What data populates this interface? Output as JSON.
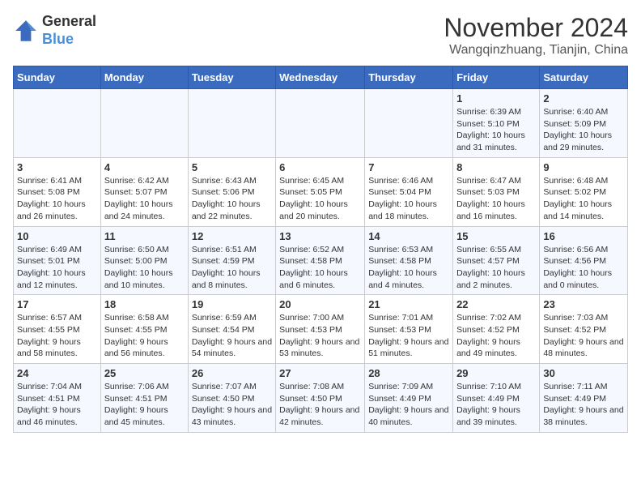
{
  "header": {
    "logo_general": "General",
    "logo_blue": "Blue",
    "month_title": "November 2024",
    "location": "Wangqinzhuang, Tianjin, China"
  },
  "weekdays": [
    "Sunday",
    "Monday",
    "Tuesday",
    "Wednesday",
    "Thursday",
    "Friday",
    "Saturday"
  ],
  "weeks": [
    [
      {
        "day": "",
        "info": ""
      },
      {
        "day": "",
        "info": ""
      },
      {
        "day": "",
        "info": ""
      },
      {
        "day": "",
        "info": ""
      },
      {
        "day": "",
        "info": ""
      },
      {
        "day": "1",
        "info": "Sunrise: 6:39 AM\nSunset: 5:10 PM\nDaylight: 10 hours and 31 minutes."
      },
      {
        "day": "2",
        "info": "Sunrise: 6:40 AM\nSunset: 5:09 PM\nDaylight: 10 hours and 29 minutes."
      }
    ],
    [
      {
        "day": "3",
        "info": "Sunrise: 6:41 AM\nSunset: 5:08 PM\nDaylight: 10 hours and 26 minutes."
      },
      {
        "day": "4",
        "info": "Sunrise: 6:42 AM\nSunset: 5:07 PM\nDaylight: 10 hours and 24 minutes."
      },
      {
        "day": "5",
        "info": "Sunrise: 6:43 AM\nSunset: 5:06 PM\nDaylight: 10 hours and 22 minutes."
      },
      {
        "day": "6",
        "info": "Sunrise: 6:45 AM\nSunset: 5:05 PM\nDaylight: 10 hours and 20 minutes."
      },
      {
        "day": "7",
        "info": "Sunrise: 6:46 AM\nSunset: 5:04 PM\nDaylight: 10 hours and 18 minutes."
      },
      {
        "day": "8",
        "info": "Sunrise: 6:47 AM\nSunset: 5:03 PM\nDaylight: 10 hours and 16 minutes."
      },
      {
        "day": "9",
        "info": "Sunrise: 6:48 AM\nSunset: 5:02 PM\nDaylight: 10 hours and 14 minutes."
      }
    ],
    [
      {
        "day": "10",
        "info": "Sunrise: 6:49 AM\nSunset: 5:01 PM\nDaylight: 10 hours and 12 minutes."
      },
      {
        "day": "11",
        "info": "Sunrise: 6:50 AM\nSunset: 5:00 PM\nDaylight: 10 hours and 10 minutes."
      },
      {
        "day": "12",
        "info": "Sunrise: 6:51 AM\nSunset: 4:59 PM\nDaylight: 10 hours and 8 minutes."
      },
      {
        "day": "13",
        "info": "Sunrise: 6:52 AM\nSunset: 4:58 PM\nDaylight: 10 hours and 6 minutes."
      },
      {
        "day": "14",
        "info": "Sunrise: 6:53 AM\nSunset: 4:58 PM\nDaylight: 10 hours and 4 minutes."
      },
      {
        "day": "15",
        "info": "Sunrise: 6:55 AM\nSunset: 4:57 PM\nDaylight: 10 hours and 2 minutes."
      },
      {
        "day": "16",
        "info": "Sunrise: 6:56 AM\nSunset: 4:56 PM\nDaylight: 10 hours and 0 minutes."
      }
    ],
    [
      {
        "day": "17",
        "info": "Sunrise: 6:57 AM\nSunset: 4:55 PM\nDaylight: 9 hours and 58 minutes."
      },
      {
        "day": "18",
        "info": "Sunrise: 6:58 AM\nSunset: 4:55 PM\nDaylight: 9 hours and 56 minutes."
      },
      {
        "day": "19",
        "info": "Sunrise: 6:59 AM\nSunset: 4:54 PM\nDaylight: 9 hours and 54 minutes."
      },
      {
        "day": "20",
        "info": "Sunrise: 7:00 AM\nSunset: 4:53 PM\nDaylight: 9 hours and 53 minutes."
      },
      {
        "day": "21",
        "info": "Sunrise: 7:01 AM\nSunset: 4:53 PM\nDaylight: 9 hours and 51 minutes."
      },
      {
        "day": "22",
        "info": "Sunrise: 7:02 AM\nSunset: 4:52 PM\nDaylight: 9 hours and 49 minutes."
      },
      {
        "day": "23",
        "info": "Sunrise: 7:03 AM\nSunset: 4:52 PM\nDaylight: 9 hours and 48 minutes."
      }
    ],
    [
      {
        "day": "24",
        "info": "Sunrise: 7:04 AM\nSunset: 4:51 PM\nDaylight: 9 hours and 46 minutes."
      },
      {
        "day": "25",
        "info": "Sunrise: 7:06 AM\nSunset: 4:51 PM\nDaylight: 9 hours and 45 minutes."
      },
      {
        "day": "26",
        "info": "Sunrise: 7:07 AM\nSunset: 4:50 PM\nDaylight: 9 hours and 43 minutes."
      },
      {
        "day": "27",
        "info": "Sunrise: 7:08 AM\nSunset: 4:50 PM\nDaylight: 9 hours and 42 minutes."
      },
      {
        "day": "28",
        "info": "Sunrise: 7:09 AM\nSunset: 4:49 PM\nDaylight: 9 hours and 40 minutes."
      },
      {
        "day": "29",
        "info": "Sunrise: 7:10 AM\nSunset: 4:49 PM\nDaylight: 9 hours and 39 minutes."
      },
      {
        "day": "30",
        "info": "Sunrise: 7:11 AM\nSunset: 4:49 PM\nDaylight: 9 hours and 38 minutes."
      }
    ]
  ]
}
